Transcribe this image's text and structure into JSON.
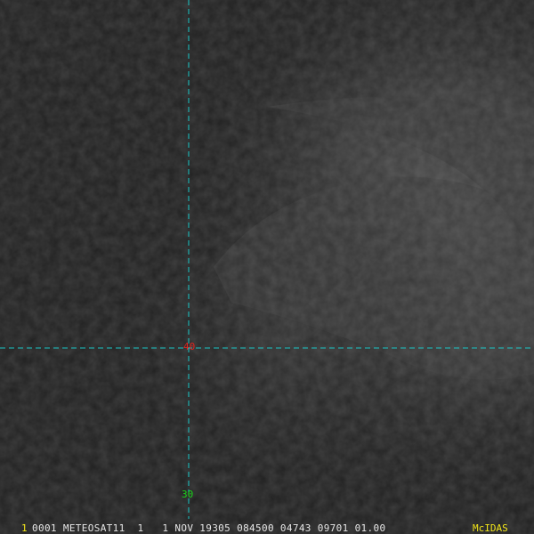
{
  "map": {
    "graticule": {
      "latitude_labels": [
        "40",
        "30"
      ]
    },
    "colors": {
      "graticule_line": "#19c8c8",
      "label_40": "#e0241f",
      "label_30": "#19d419",
      "status_highlight": "#f2e51a",
      "status_text": "#e6e6e6"
    }
  },
  "status_bar": {
    "frame_number": "1",
    "info": "0001 METEOSAT11  1   1 NOV 19305 084500 04743 09701 01.00",
    "brand": "McIDAS"
  }
}
